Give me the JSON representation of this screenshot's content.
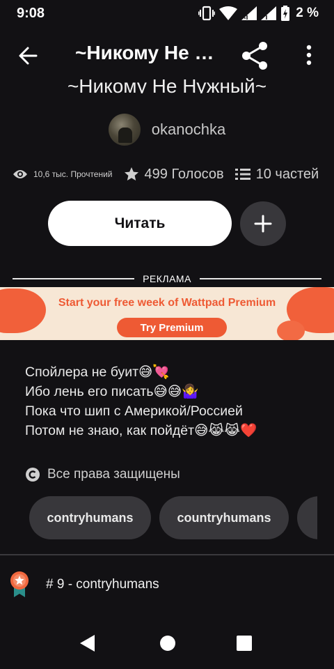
{
  "status_bar": {
    "time": "9:08",
    "battery_percent": "2 %",
    "icons": [
      "vibrate-icon",
      "wifi-icon",
      "signal-icon",
      "signal-icon",
      "battery-charging-icon"
    ]
  },
  "app_bar": {
    "title": "~Никому Не Нужный~",
    "icons": [
      "back-arrow-icon",
      "share-icon",
      "more-vertical-icon"
    ]
  },
  "story": {
    "title": "~Никому Не Нужный~",
    "author": "okanochka",
    "stats": {
      "reads": "10,6 тыс. Прочтений",
      "votes": "499 Голосов",
      "parts": "10 частей"
    },
    "read_button": "Читать",
    "add_icon": "plus-icon"
  },
  "ad": {
    "label": "РЕКЛАМА",
    "headline": "Start your free week of Wattpad Premium",
    "cta": "Try Premium",
    "colors": {
      "background": "#f7e7d5",
      "accent": "#ee5a34"
    }
  },
  "description": {
    "lines": [
      "Спойлера не буит😅💘",
      "Ибо лень его писать😅😅🤷‍♀️",
      "Пока что шип с Америкой/Россией",
      "Потом не знаю, как пойдёт😅😹😹❤️"
    ]
  },
  "copyright": {
    "text": "Все права защищены",
    "icon": "copyright-icon"
  },
  "tags": [
    "contryhumans",
    "countryhumans",
    ""
  ],
  "ranking": {
    "text": "# 9 - contryhumans",
    "icon": "ranking-badge-icon"
  },
  "nav": {
    "icons": [
      "nav-back-icon",
      "nav-home-icon",
      "nav-recents-icon"
    ]
  },
  "colors": {
    "background": "#121114",
    "surface": "#38373b",
    "text": "#ffffff",
    "badge_orange": "#f0683f",
    "badge_teal": "#2a8e8a"
  }
}
